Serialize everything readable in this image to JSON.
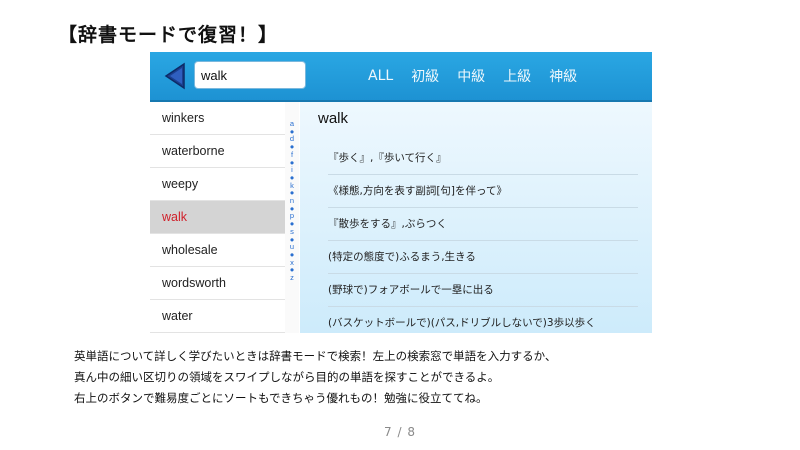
{
  "heading": "【辞書モードで復習！】",
  "app": {
    "search": {
      "value": "walk",
      "icon": "back-arrow-icon"
    },
    "tabs": [
      {
        "label": "ALL"
      },
      {
        "label": "初級"
      },
      {
        "label": "中級"
      },
      {
        "label": "上級"
      },
      {
        "label": "神級"
      }
    ],
    "word_list": [
      {
        "label": "winkers"
      },
      {
        "label": "waterborne"
      },
      {
        "label": "weepy"
      },
      {
        "label": "walk",
        "selected": true
      },
      {
        "label": "wholesale"
      },
      {
        "label": "wordsworth"
      },
      {
        "label": "water"
      }
    ],
    "alphabet_index": [
      "a",
      "●",
      "d",
      "●",
      "f",
      "●",
      "i",
      "●",
      "k",
      "●",
      "n",
      "●",
      "p",
      "●",
      "s",
      "●",
      "u",
      "●",
      "x",
      "●",
      "z"
    ],
    "entry": {
      "title": "walk",
      "definitions": [
        "『歩く』,『歩いて行く』",
        "《様態,方向を表す副詞[句]を伴って》",
        "『散歩をする』,ぶらつく",
        "(特定の態度で)ふるまう,生きる",
        "(野球で)フォアボールで一塁に出る",
        "(バスケットボールで)(パス,ドリブルしないで)3歩以歩く"
      ]
    },
    "colors": {
      "header": "#1d92d3",
      "selected_text": "#d0202a",
      "accent": "#2a6fd0"
    }
  },
  "caption": [
    "英単語について詳しく学びたいときは辞書モードで検索！左上の検索窓で単語を入力するか、",
    "真ん中の細い区切りの領域をスワイプしながら目的の単語を探すことができるよ。",
    "右上のボタンで難易度ごとにソートもできちゃう優れもの！勉強に役立ててね。"
  ],
  "page_number": "7 / 8"
}
